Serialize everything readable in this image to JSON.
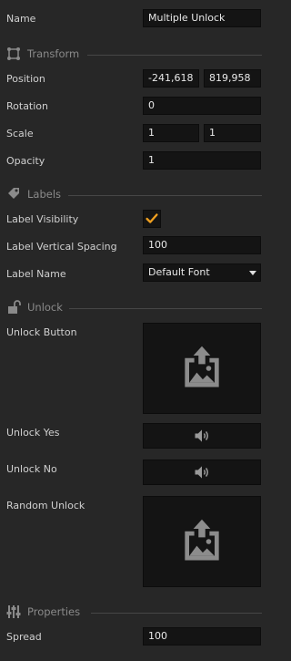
{
  "name": {
    "label": "Name",
    "value": "Multiple Unlock"
  },
  "transform": {
    "title": "Transform",
    "position": {
      "label": "Position",
      "x": "-241,618",
      "y": "819,958"
    },
    "rotation": {
      "label": "Rotation",
      "value": "0"
    },
    "scale": {
      "label": "Scale",
      "x": "1",
      "y": "1"
    },
    "opacity": {
      "label": "Opacity",
      "value": "1"
    }
  },
  "labels": {
    "title": "Labels",
    "visibility": {
      "label": "Label Visibility",
      "checked": true
    },
    "vertical_spacing": {
      "label": "Label Vertical Spacing",
      "value": "100"
    },
    "name": {
      "label": "Label Name",
      "value": "Default Font"
    }
  },
  "unlock": {
    "title": "Unlock",
    "button": {
      "label": "Unlock Button"
    },
    "yes": {
      "label": "Unlock Yes"
    },
    "no": {
      "label": "Unlock No"
    },
    "random": {
      "label": "Random Unlock"
    }
  },
  "properties": {
    "title": "Properties",
    "spread": {
      "label": "Spread",
      "value": "100"
    }
  },
  "colors": {
    "accent": "#f0a020",
    "icon": "#9a9a9a",
    "field_bg": "#141414",
    "panel_bg": "#272727"
  }
}
